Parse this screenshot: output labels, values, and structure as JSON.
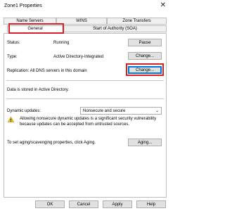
{
  "window": {
    "title": "Zone1 Properties",
    "close_glyph": "✕"
  },
  "tabs": {
    "row1": [
      "Name Servers",
      "WINS",
      "Zone Transfers"
    ],
    "row2": [
      "General",
      "Start of Authority (SOA)"
    ]
  },
  "general": {
    "status_label": "Status:",
    "status_value": "Running",
    "pause_button": "Pause",
    "type_label": "Type:",
    "type_value": "Active Directory-Integrated",
    "change_type_button": "Change...",
    "replication_text": "Replication:  All DNS servers in this domain",
    "change_replication_button": "Change...",
    "data_stored_text": "Data is stored in Active Directory.",
    "dynamic_updates_label": "Dynamic updates:",
    "dynamic_updates_value": "Nonsecure and secure",
    "warning_text": "Allowing nonsecure dynamic updates is a significant security vulnerability because updates can be accepted from untrusted sources.",
    "aging_text": "To set aging/scavenging properties, click Aging.",
    "aging_button": "Aging..."
  },
  "footer": {
    "ok": "OK",
    "cancel": "Cancel",
    "apply": "Apply",
    "help": "Help"
  },
  "icons": {
    "warning": "warning-icon",
    "dropdown": "chevron-down-icon",
    "close": "close-icon"
  },
  "colors": {
    "highlight": "#d61f26",
    "focus": "#0078d7"
  }
}
